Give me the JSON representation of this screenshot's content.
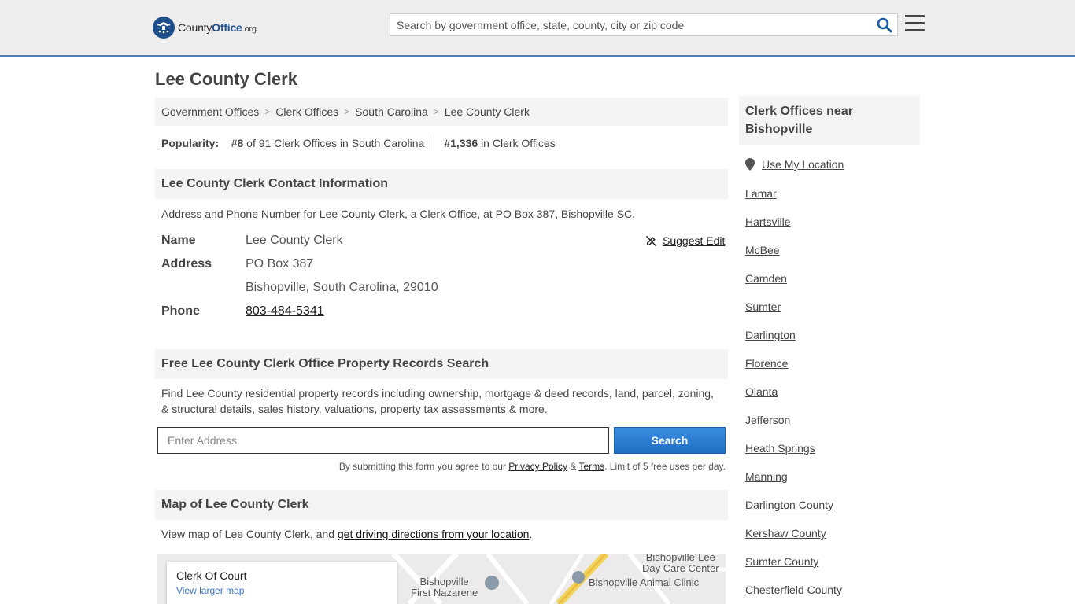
{
  "header": {
    "logo_county": "County",
    "logo_office": "Office",
    "logo_org": ".org",
    "search_placeholder": "Search by government office, state, county, city or zip code"
  },
  "page": {
    "title": "Lee County Clerk"
  },
  "breadcrumb": [
    "Government Offices",
    "Clerk Offices",
    "South Carolina",
    "Lee County Clerk"
  ],
  "breadcrumb_sep": ">",
  "popularity": {
    "label": "Popularity:",
    "state_rank": "#8",
    "state_text": "of 91 Clerk Offices in South Carolina",
    "national_rank": "#1,336",
    "national_text": "in Clerk Offices"
  },
  "contact": {
    "heading": "Lee County Clerk Contact Information",
    "description": "Address and Phone Number for Lee County Clerk, a Clerk Office, at PO Box 387, Bishopville SC.",
    "name_label": "Name",
    "name_value": "Lee County Clerk",
    "address_label": "Address",
    "address_line1": "PO Box 387",
    "address_line2": "Bishopville, South Carolina, 29010",
    "phone_label": "Phone",
    "phone_value": "803-484-5341",
    "suggest_edit": "Suggest Edit"
  },
  "property": {
    "heading": "Free Lee County Clerk Office Property Records Search",
    "description_line1": "Find Lee County residential property records including ownership, mortgage & deed records, land, parcel, zoning,",
    "description_line2": "& structural details, sales history, valuations, property tax assessments & more.",
    "input_placeholder": "Enter Address",
    "button_label": "Search",
    "disclaimer_pre": "By submitting this form you agree to our",
    "privacy_link": "Privacy Policy",
    "amp": "&",
    "terms_link": "Terms",
    "disclaimer_post": ". Limit of 5 free uses per day."
  },
  "map_section": {
    "heading": "Map of Lee County Clerk",
    "description_pre": "View map of Lee County Clerk, and",
    "directions_link": "get driving directions from your location",
    "description_post": ".",
    "card_title": "Clerk Of Court",
    "card_link": "View larger map",
    "poi_1a": "Bishopville",
    "poi_1b": "First Nazarene",
    "poi_2a": "Bishopville-Lee",
    "poi_2b": "Day Care Center",
    "poi_3": "Bishopville Animal Clinic"
  },
  "sidebar": {
    "heading_line1": "Clerk Offices near",
    "heading_line2": "Bishopville",
    "use_location": "Use My Location",
    "cities": [
      "Lamar",
      "Hartsville",
      "McBee",
      "Camden",
      "Sumter",
      "Darlington",
      "Florence",
      "Olanta",
      "Jefferson",
      "Heath Springs",
      "Manning",
      "Darlington County",
      "Kershaw County",
      "Sumter County",
      "Chesterfield County"
    ]
  },
  "colors": {
    "brand": "#1d4f8a",
    "button": "#1f6fc4",
    "header_bg": "#eeeeee",
    "section_bg": "#f4f4f4"
  }
}
